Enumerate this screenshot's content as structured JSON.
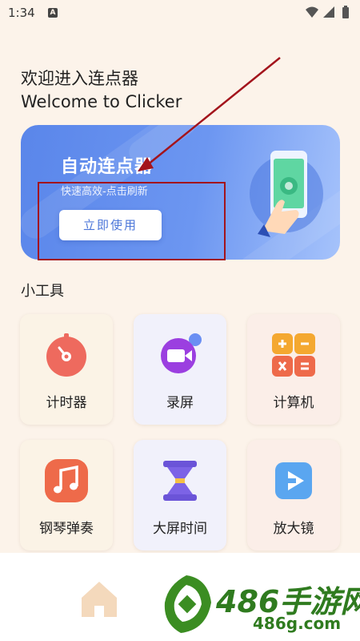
{
  "status_bar": {
    "time": "1:34",
    "notification_letter": "A",
    "icons": [
      "wifi-icon",
      "signal-icon",
      "battery-icon"
    ]
  },
  "greeting": {
    "line1": "欢迎进入连点器",
    "line2": "Welcome to Clicker"
  },
  "banner": {
    "title": "自动连点器",
    "subtitle": "快速高效-点击刷新",
    "button_label": "立即使用",
    "colors": {
      "gradient_start": "#5a86ea",
      "gradient_end": "#a6c3fb"
    }
  },
  "tools": {
    "section_title": "小工具",
    "items": [
      {
        "label": "计时器",
        "icon": "timer-icon"
      },
      {
        "label": "录屏",
        "icon": "screen-record-icon"
      },
      {
        "label": "计算机",
        "icon": "calculator-icon"
      },
      {
        "label": "钢琴弹奏",
        "icon": "music-note-icon"
      },
      {
        "label": "大屏时间",
        "icon": "hourglass-icon"
      },
      {
        "label": "放大镜",
        "icon": "magnifier-icon"
      }
    ]
  },
  "bottom_nav": {
    "items": [
      {
        "icon": "home-icon"
      }
    ]
  },
  "watermark": {
    "main": "486手游网",
    "sub": "486g.com"
  },
  "annotation": {
    "color": "#a3141c"
  }
}
